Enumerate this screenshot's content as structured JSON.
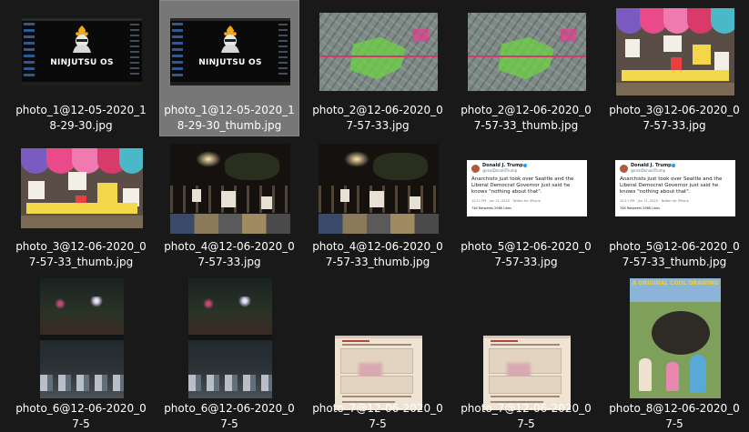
{
  "files": [
    {
      "name": "photo_1@12-05-2020_18-29-30.jpg",
      "selected": false,
      "logo_text": "NINJUTSU OS"
    },
    {
      "name": "photo_1@12-05-2020_18-29-30_thumb.jpg",
      "selected": true,
      "logo_text": "NINJUTSU OS"
    },
    {
      "name": "photo_2@12-06-2020_07-57-33.jpg",
      "selected": false
    },
    {
      "name": "photo_2@12-06-2020_07-57-33_thumb.jpg",
      "selected": false
    },
    {
      "name": "photo_3@12-06-2020_07-57-33.jpg",
      "selected": false
    },
    {
      "name": "photo_3@12-06-2020_07-57-33_thumb.jpg",
      "selected": false
    },
    {
      "name": "photo_4@12-06-2020_07-57-33.jpg",
      "selected": false
    },
    {
      "name": "photo_4@12-06-2020_07-57-33_thumb.jpg",
      "selected": false
    },
    {
      "name": "photo_5@12-06-2020_07-57-33.jpg",
      "selected": false,
      "tweet": {
        "author": "Donald J. Trump",
        "handle": "@realDonaldTrump",
        "text": "Anarchists just took over Seattle and the Liberal Democrat Governor just said he knows \"nothing about that\".",
        "meta": "10:11 PM · Jun 11, 2020 · Twitter for iPhone",
        "stats": "74K Retweets   296K Likes"
      }
    },
    {
      "name": "photo_5@12-06-2020_07-57-33_thumb.jpg",
      "selected": false,
      "tweet": {
        "author": "Donald J. Trump",
        "handle": "@realDonaldTrump",
        "text": "Anarchists just took over Seattle and the Liberal Democrat Governor just said he knows \"nothing about that\".",
        "meta": "10:11 PM · Jun 11, 2020 · Twitter for iPhone",
        "stats": "74K Retweets   296K Likes"
      }
    },
    {
      "name": "photo_6@12-06-2020_07-5",
      "selected": false
    },
    {
      "name": "photo_6@12-06-2020_07-5",
      "selected": false
    },
    {
      "name": "photo_7@12-06-2020_07-5",
      "selected": false
    },
    {
      "name": "photo_7@12-06-2020_07-5",
      "selected": false
    },
    {
      "name": "photo_8@12-06-2020_07-5",
      "selected": false,
      "banner_text": "A ORIGINAL COOL DRAWING"
    }
  ]
}
